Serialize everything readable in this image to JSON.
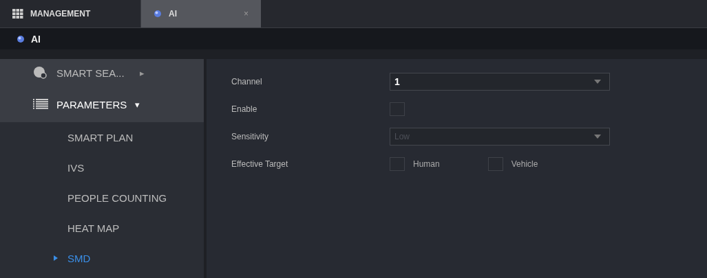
{
  "top_tabs": [
    {
      "label": "MANAGEMENT",
      "kind": "home",
      "selected": false
    },
    {
      "label": "AI",
      "kind": "page",
      "selected": true,
      "close": "×"
    }
  ],
  "header": {
    "title": "AI"
  },
  "sidebar": {
    "items": [
      {
        "label": "SMART SEA...",
        "kind": "search",
        "arrow": "▸",
        "expanded": false
      },
      {
        "label": "PARAMETERS",
        "kind": "list",
        "arrow": "▾",
        "expanded": true,
        "children": [
          {
            "label": "SMART PLAN",
            "selected": false
          },
          {
            "label": "IVS",
            "selected": false
          },
          {
            "label": "PEOPLE COUNTING",
            "selected": false
          },
          {
            "label": "HEAT MAP",
            "selected": false
          },
          {
            "label": "SMD",
            "selected": true
          }
        ]
      }
    ]
  },
  "form": {
    "fields": [
      {
        "label": "Channel",
        "kind": "select",
        "value": "1",
        "disabled": false
      },
      {
        "label": "Enable",
        "kind": "checkbox",
        "checked": false
      },
      {
        "label": "Sensitivity",
        "kind": "select",
        "value": "Low",
        "disabled": true
      },
      {
        "label": "Effective Target",
        "kind": "checks",
        "options": [
          {
            "label": "Human",
            "checked": false
          },
          {
            "label": "Vehicle",
            "checked": false
          }
        ]
      }
    ]
  }
}
